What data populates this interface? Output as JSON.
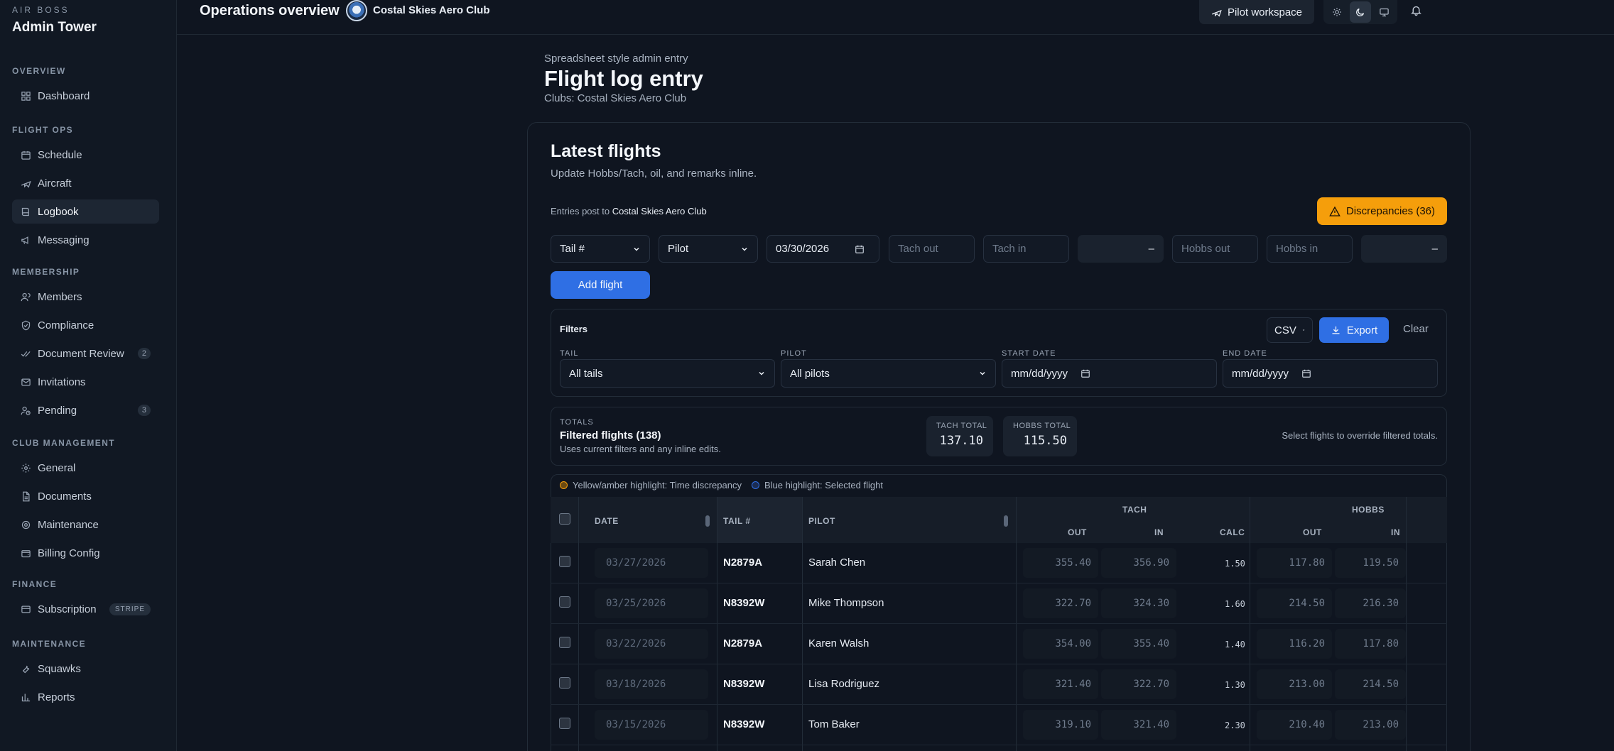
{
  "brand": {
    "eyebrow": "AIR BOSS",
    "name": "Admin Tower"
  },
  "sidebar": {
    "sections": [
      {
        "title": "OVERVIEW",
        "items": [
          {
            "label": "Dashboard",
            "icon": "grid-icon"
          }
        ]
      },
      {
        "title": "FLIGHT OPS",
        "items": [
          {
            "label": "Schedule",
            "icon": "calendar-icon"
          },
          {
            "label": "Aircraft",
            "icon": "plane-icon"
          },
          {
            "label": "Logbook",
            "icon": "book-icon",
            "active": true
          },
          {
            "label": "Messaging",
            "icon": "megaphone-icon"
          }
        ]
      },
      {
        "title": "MEMBERSHIP",
        "items": [
          {
            "label": "Members",
            "icon": "users-icon"
          },
          {
            "label": "Compliance",
            "icon": "shield-check-icon"
          },
          {
            "label": "Document Review",
            "icon": "check-double-icon",
            "badge": "2"
          },
          {
            "label": "Invitations",
            "icon": "mail-icon"
          },
          {
            "label": "Pending",
            "icon": "user-clock-icon",
            "badge": "3"
          }
        ]
      },
      {
        "title": "CLUB MANAGEMENT",
        "items": [
          {
            "label": "General",
            "icon": "gear-icon"
          },
          {
            "label": "Documents",
            "icon": "file-icon"
          },
          {
            "label": "Maintenance",
            "icon": "cog-icon"
          },
          {
            "label": "Billing Config",
            "icon": "wallet-icon"
          }
        ]
      },
      {
        "title": "FINANCE",
        "items": [
          {
            "label": "Subscription",
            "icon": "card-icon",
            "badge": "STRIPE"
          }
        ]
      },
      {
        "title": "MAINTENANCE",
        "items": [
          {
            "label": "Squawks",
            "icon": "wrench-icon"
          },
          {
            "label": "Reports",
            "icon": "bar-chart-icon"
          }
        ]
      }
    ]
  },
  "topbar": {
    "title": "Operations overview",
    "club": "Costal Skies Aero Club",
    "pilot_workspace": "Pilot workspace"
  },
  "header": {
    "eyebrow": "Spreadsheet style admin entry",
    "title": "Flight log entry",
    "clubs": "Clubs: Costal Skies Aero Club"
  },
  "card": {
    "title": "Latest flights",
    "subtitle": "Update Hobbs/Tach, oil, and remarks inline.",
    "posts_prefix": "Entries post to",
    "posts_club": "Costal Skies Aero Club",
    "discrepancies": "Discrepancies (36)"
  },
  "entry": {
    "tail": "Tail #",
    "pilot": "Pilot",
    "date": "03/30/2026",
    "tach_out": "Tach out",
    "tach_in": "Tach in",
    "tach_calc": "–",
    "hobbs_out": "Hobbs out",
    "hobbs_in": "Hobbs in",
    "hobbs_calc": "–",
    "add": "Add flight"
  },
  "filters": {
    "title": "Filters",
    "format": "CSV",
    "export": "Export",
    "clear": "Clear",
    "tail_label": "TAIL",
    "tail_value": "All tails",
    "pilot_label": "PILOT",
    "pilot_value": "All pilots",
    "start_label": "START DATE",
    "start_value": "mm/dd/yyyy",
    "end_label": "END DATE",
    "end_value": "mm/dd/yyyy"
  },
  "totals": {
    "eyebrow": "TOTALS",
    "title": "Filtered flights (138)",
    "sub": "Uses current filters and any inline edits.",
    "tach_label": "TACH TOTAL",
    "tach_value": "137.10",
    "hobbs_label": "HOBBS TOTAL",
    "hobbs_value": "115.50",
    "hint": "Select flights to override filtered totals."
  },
  "legend": {
    "amber": "Yellow/amber highlight: Time discrepancy",
    "blue": "Blue highlight: Selected flight",
    "amber_color": "#f59e0b",
    "blue_color": "#2f6fe4"
  },
  "table": {
    "headers": {
      "date": "DATE",
      "tail": "TAIL #",
      "pilot": "PILOT",
      "tach": "TACH",
      "hobbs": "HOBBS",
      "tach_out": "OUT",
      "tach_in": "IN",
      "tach_calc": "CALC",
      "hobbs_out": "OUT",
      "hobbs_in": "IN"
    },
    "rows": [
      {
        "date": "03/27/2026",
        "tail": "N2879A",
        "pilot": "Sarah Chen",
        "tach_out": "355.40",
        "tach_in": "356.90",
        "calc": "1.50",
        "hobbs_out": "117.80",
        "hobbs_in": "119.50"
      },
      {
        "date": "03/25/2026",
        "tail": "N8392W",
        "pilot": "Mike Thompson",
        "tach_out": "322.70",
        "tach_in": "324.30",
        "calc": "1.60",
        "hobbs_out": "214.50",
        "hobbs_in": "216.30"
      },
      {
        "date": "03/22/2026",
        "tail": "N2879A",
        "pilot": "Karen Walsh",
        "tach_out": "354.00",
        "tach_in": "355.40",
        "calc": "1.40",
        "hobbs_out": "116.20",
        "hobbs_in": "117.80"
      },
      {
        "date": "03/18/2026",
        "tail": "N8392W",
        "pilot": "Lisa Rodriguez",
        "tach_out": "321.40",
        "tach_in": "322.70",
        "calc": "1.30",
        "hobbs_out": "213.00",
        "hobbs_in": "214.50"
      },
      {
        "date": "03/15/2026",
        "tail": "N8392W",
        "pilot": "Tom Baker",
        "tach_out": "319.10",
        "tach_in": "321.40",
        "calc": "2.30",
        "hobbs_out": "210.40",
        "hobbs_in": "213.00"
      }
    ]
  }
}
